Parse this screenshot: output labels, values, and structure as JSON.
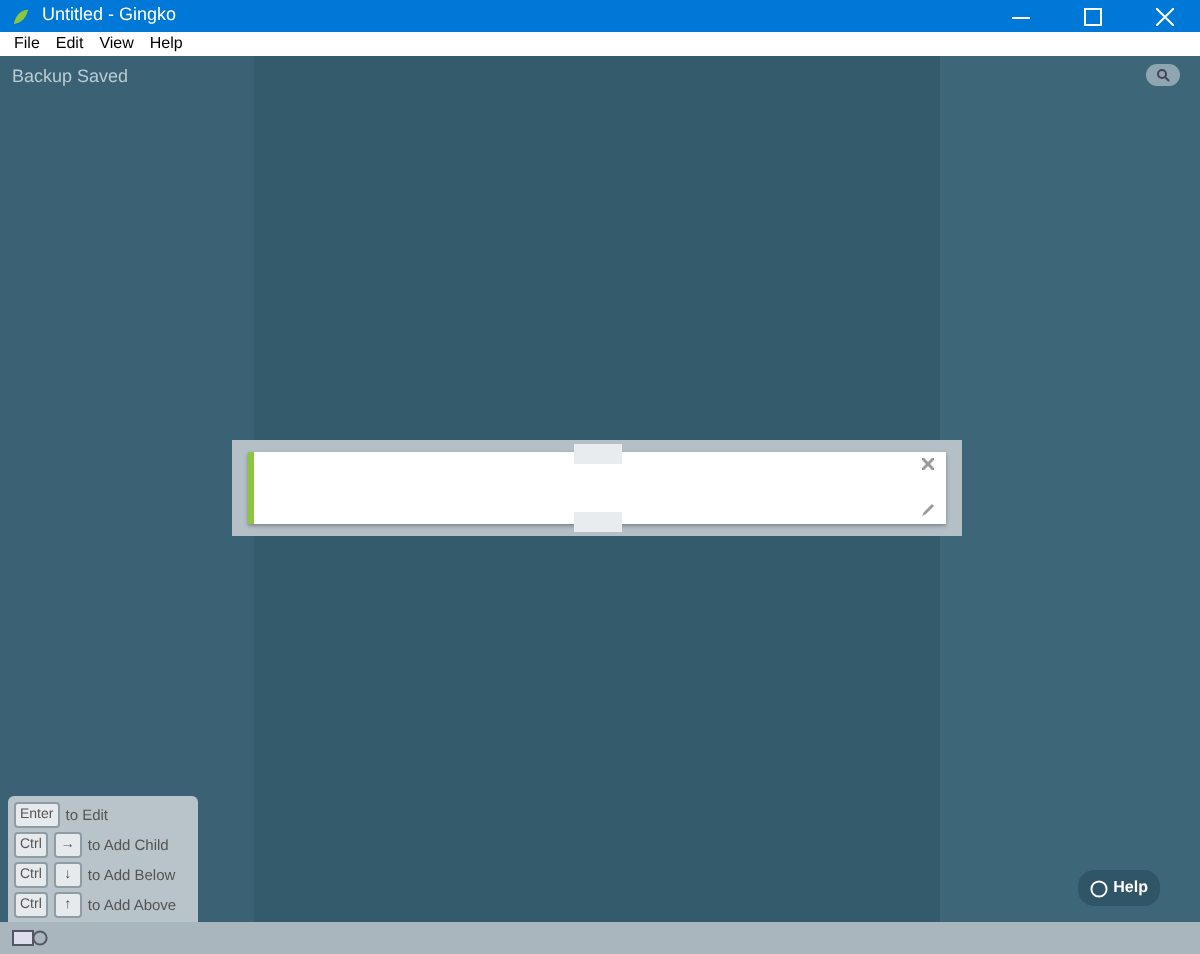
{
  "window": {
    "title": "Untitled - Gingko"
  },
  "menu": [
    "File",
    "Edit",
    "View",
    "Help"
  ],
  "status": "Backup Saved",
  "shortcuts": [
    {
      "keys": [
        "Enter"
      ],
      "text": "to Edit"
    },
    {
      "keys": [
        "Ctrl",
        "→"
      ],
      "text": "to Add Child"
    },
    {
      "keys": [
        "Ctrl",
        "↓"
      ],
      "text": "to Add Below"
    },
    {
      "keys": [
        "Ctrl",
        "↑"
      ],
      "text": "to Add Above"
    }
  ],
  "help": {
    "label": "Help"
  }
}
